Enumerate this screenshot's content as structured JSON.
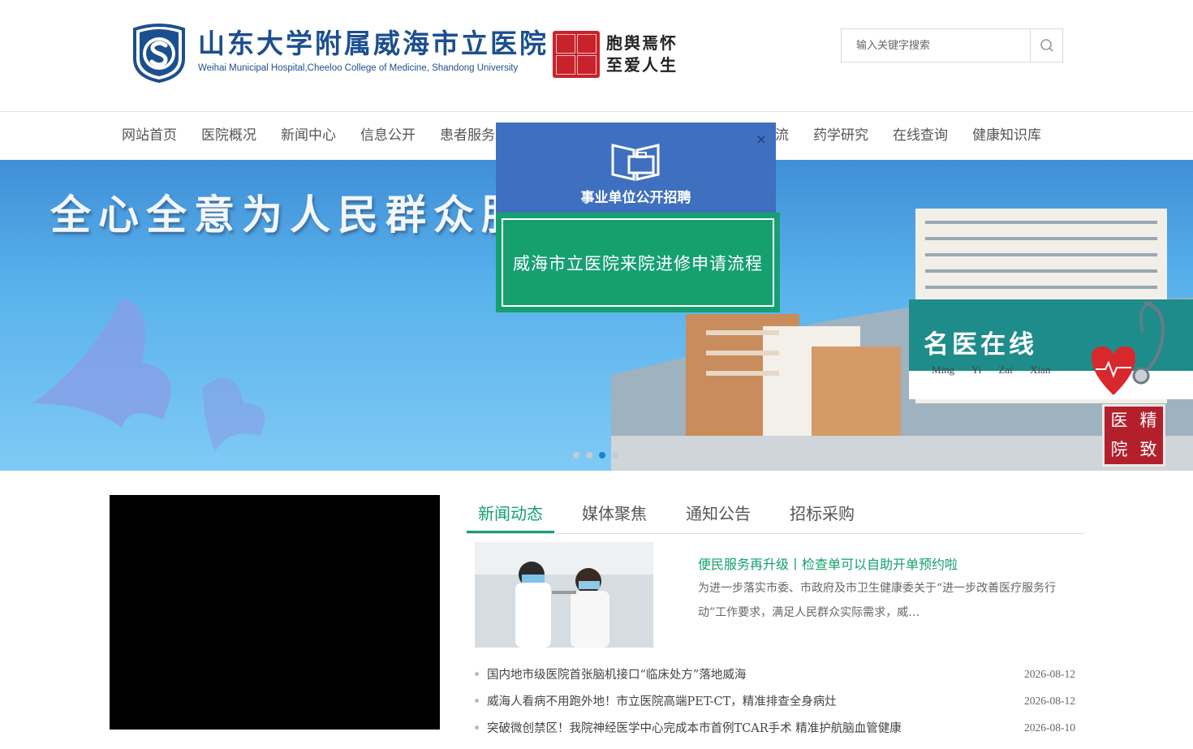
{
  "header": {
    "hospital_name_cn": "山东大学附属威海市立医院",
    "hospital_name_en": "Weihai Municipal Hospital,Cheeloo College of Medicine, Shandong University",
    "motto_line1": "胞舆焉怀",
    "motto_line2": "至爱人生",
    "search": {
      "placeholder": "输入关键字搜索"
    }
  },
  "nav": {
    "items": [
      {
        "label": "网站首页"
      },
      {
        "label": "医院概况"
      },
      {
        "label": "新闻中心"
      },
      {
        "label": "信息公开"
      },
      {
        "label": "患者服务"
      },
      {
        "label": ""
      },
      {
        "label": ""
      },
      {
        "label": ""
      },
      {
        "label": "合作交流"
      },
      {
        "label": "药学研究"
      },
      {
        "label": "在线查询"
      },
      {
        "label": "健康知识库"
      }
    ]
  },
  "banner": {
    "slogan": "全心全意为人民群众服务",
    "stamp": [
      "医",
      "精",
      "院",
      "致"
    ],
    "dots": 4,
    "active_dot": 3
  },
  "popup": {
    "recruit_label": "事业单位公开招聘",
    "training_label": "威海市立医院来院进修申请流程",
    "close_symbol": "×"
  },
  "mingyi": {
    "title": "名医在线",
    "subtitle": "Ming Yi Zai Xian"
  },
  "news": {
    "tabs": [
      {
        "label": "新闻动态",
        "active": true
      },
      {
        "label": "媒体聚焦",
        "active": false
      },
      {
        "label": "通知公告",
        "active": false
      },
      {
        "label": "招标采购",
        "active": false
      }
    ],
    "feature": {
      "title": "便民服务再升级丨检查单可以自助开单预约啦",
      "desc": "为进一步落实市委、市政府及市卫生健康委关于“进一步改善医疗服务行动”工作要求，满足人民群众实际需求，威…"
    },
    "items": [
      {
        "title": "国内地市级医院首张脑机接口“临床处方”落地威海",
        "date": "2026-08-12"
      },
      {
        "title": "威海人看病不用跑外地！市立医院高端PET-CT，精准排查全身病灶",
        "date": "2026-08-12"
      },
      {
        "title": "突破微创禁区！我院神经医学中心完成本市首例TCAR手术 精准护航脑血管健康",
        "date": "2026-08-10"
      }
    ]
  }
}
